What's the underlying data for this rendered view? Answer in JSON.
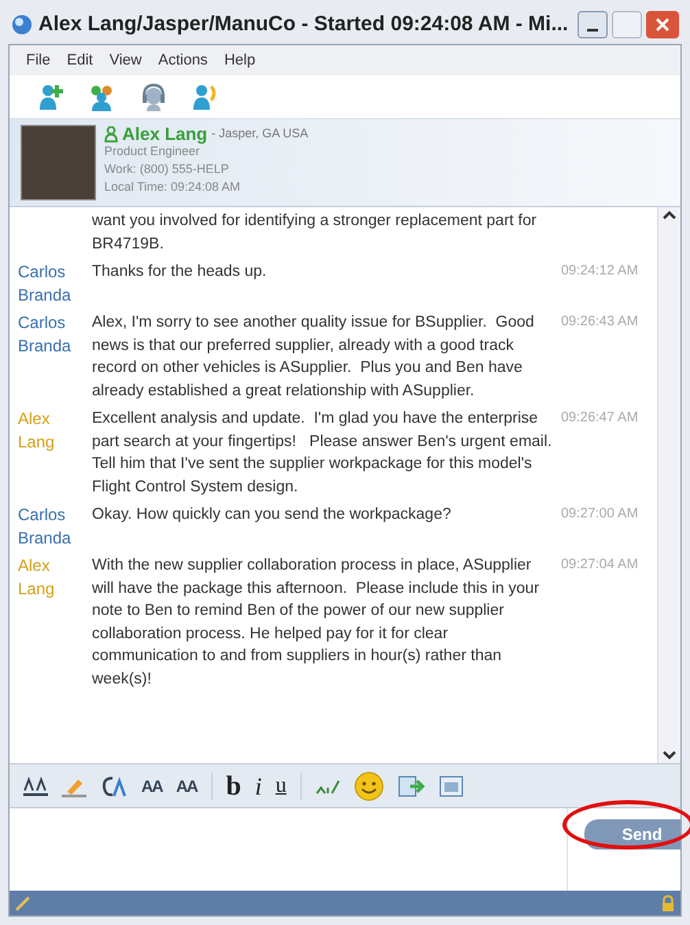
{
  "window": {
    "title": "Alex Lang/Jasper/ManuCo - Started 09:24:08 AM - Mi..."
  },
  "menu": [
    "File",
    "Edit",
    "View",
    "Actions",
    "Help"
  ],
  "contact": {
    "name": "Alex Lang",
    "location": "- Jasper, GA USA",
    "role": "Product Engineer",
    "work": "Work: (800) 555-HELP",
    "local_time": "Local Time: 09:24:08 AM"
  },
  "messages": [
    {
      "text": "want you involved for identifying a stronger replacement part for BR4719B."
    },
    {
      "sender": "Carlos Branda",
      "kind": "received",
      "text": "Thanks for the heads up.",
      "time": "09:24:12 AM"
    },
    {
      "sender": "Carlos Branda",
      "kind": "received",
      "text": "Alex, I'm sorry to see another quality issue for BSupplier.  Good news is that our preferred supplier, already with a good track record on other vehicles is ASupplier.  Plus you and Ben have already established a great relationship with ASupplier.",
      "time": "09:26:43 AM"
    },
    {
      "sender": "Alex Lang",
      "kind": "sent",
      "text": "Excellent analysis and update.  I'm glad you have the enterprise part search at your fingertips!   Please answer Ben's urgent email.   Tell him that I've sent the supplier workpackage for this model's Flight Control System design.",
      "time": "09:26:47 AM"
    },
    {
      "sender": "Carlos Branda",
      "kind": "received",
      "text": "Okay. How quickly can you send the workpackage?",
      "time": "09:27:00 AM"
    },
    {
      "sender": "Alex Lang",
      "kind": "sent",
      "text": "With the new supplier collaboration process in place, ASupplier will have the package this afternoon.  Please include this in your note to Ben to remind Ben of the power of our new supplier collaboration process. He helped pay for it for clear communication to and from suppliers in hour(s) rather than week(s)!",
      "time": "09:27:04 AM"
    }
  ],
  "format_toolbar": {
    "font_size_1": "AA",
    "font_size_2": "AA",
    "bold": "b",
    "italic": "i",
    "underline": "u"
  },
  "send_button": "Send"
}
